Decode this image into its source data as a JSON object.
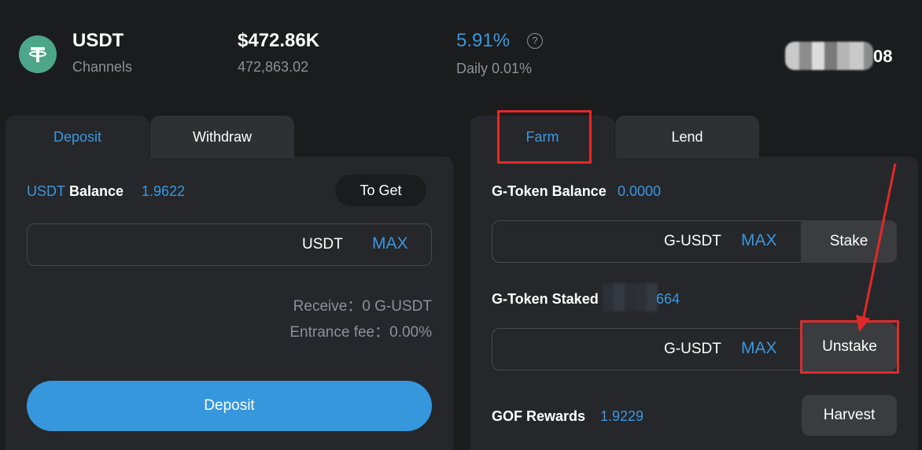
{
  "header": {
    "token_name": "USDT",
    "token_sub": "Channels",
    "tvl": "$472.86K",
    "tvl_exact": "472,863.02",
    "apy": "5.91%",
    "daily": "Daily 0.01%",
    "address_suffix": "08",
    "help_glyph": "?"
  },
  "left_tabs": [
    {
      "label": "Deposit",
      "active": true
    },
    {
      "label": "Withdraw",
      "active": false
    }
  ],
  "deposit_panel": {
    "balance_token": "USDT",
    "balance_label": " Balance",
    "balance_value": "1.9622",
    "to_get_label": "To Get",
    "input_unit": "USDT",
    "max_label": "MAX",
    "receive": "Receive：0 G-USDT",
    "entrance_fee": "Entrance fee：0.00%",
    "deposit_button": "Deposit"
  },
  "right_tabs": [
    {
      "label": "Farm",
      "active": true
    },
    {
      "label": "Lend",
      "active": false
    }
  ],
  "farm_panel": {
    "gtoken_balance_label": "G-Token Balance",
    "gtoken_balance_value": "0.0000",
    "stake_unit": "G-USDT",
    "stake_max": "MAX",
    "stake_button": "Stake",
    "staked_label": "G-Token Staked",
    "staked_value_suffix": "664",
    "unstake_unit": "G-USDT",
    "unstake_max": "MAX",
    "unstake_button": "Unstake",
    "rewards_label": "GOF Rewards",
    "rewards_value": "1.9229",
    "harvest_button": "Harvest"
  },
  "colors": {
    "accent": "#3a97e0",
    "highlight": "#e02a2a",
    "token_logo": "#4ea688"
  },
  "icons": [
    "tether-icon",
    "help-circle-icon"
  ]
}
